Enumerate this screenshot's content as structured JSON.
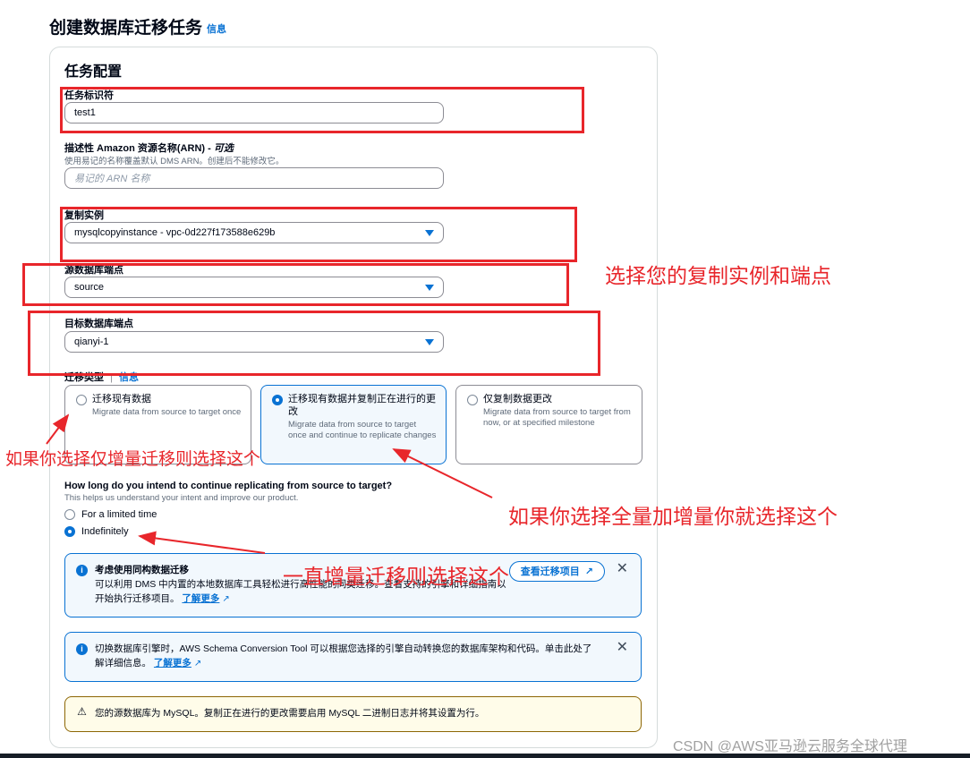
{
  "page": {
    "title": "创建数据库迁移任务",
    "info_link": "信息"
  },
  "panel": {
    "title": "任务配置",
    "task_identifier": {
      "label": "任务标识符",
      "value": "test1"
    },
    "arn": {
      "label_prefix": "描述性 Amazon 资源名称(ARN) - ",
      "label_optional": "可选",
      "description": "使用易记的名称覆盖默认 DMS ARN。创建后不能修改它。",
      "placeholder": "易记的 ARN 名称"
    },
    "replication_instance": {
      "label": "复制实例",
      "value": "mysqlcopyinstance - vpc-0d227f173588e629b"
    },
    "source_endpoint": {
      "label": "源数据库端点",
      "value": "source"
    },
    "target_endpoint": {
      "label": "目标数据库端点",
      "value": "qianyi-1"
    },
    "migration_type": {
      "label": "迁移类型",
      "info_link": "信息",
      "options": [
        {
          "title": "迁移现有数据",
          "description": "Migrate data from source to target once",
          "selected": false
        },
        {
          "title": "迁移现有数据并复制正在进行的更改",
          "description": "Migrate data from source to target once and continue to replicate changes",
          "selected": true
        },
        {
          "title": "仅复制数据更改",
          "description": "Migrate data from source to target from now, or at specified milestone",
          "selected": false
        }
      ]
    },
    "duration": {
      "question": "How long do you intend to continue replicating from source to target?",
      "description": "This helps us understand your intent and improve our product.",
      "options": [
        {
          "label": "For a limited time",
          "selected": false
        },
        {
          "label": "Indefinitely",
          "selected": true
        }
      ]
    },
    "alert_homogeneous": {
      "title": "考虑使用同构数据迁移",
      "body": "可以利用 DMS 中内置的本地数据库工具轻松进行高性能的同类迁移。查看支持的引擎和详细指南以开始执行迁移项目。",
      "link": "了解更多",
      "button": "查看迁移项目"
    },
    "alert_sct": {
      "body": "切换数据库引擎时，AWS Schema Conversion Tool 可以根据您选择的引擎自动转换您的数据库架构和代码。单击此处了解详细信息。",
      "link": "了解更多"
    },
    "alert_warning": {
      "body": "您的源数据库为 MySQL。复制正在进行的更改需要启用 MySQL 二进制日志并将其设置为行。"
    }
  },
  "annotations": {
    "select_instance_endpoints": "选择您的复制实例和端点",
    "incremental_only": "如果你选择仅增量迁移则选择这个",
    "full_plus_incremental": "如果你选择全量加增量你就选择这个",
    "always_incremental": "一直增量迁移则选择这个",
    "color": "#e8262b"
  },
  "watermark": "CSDN @AWS亚马逊云服务全球代理"
}
